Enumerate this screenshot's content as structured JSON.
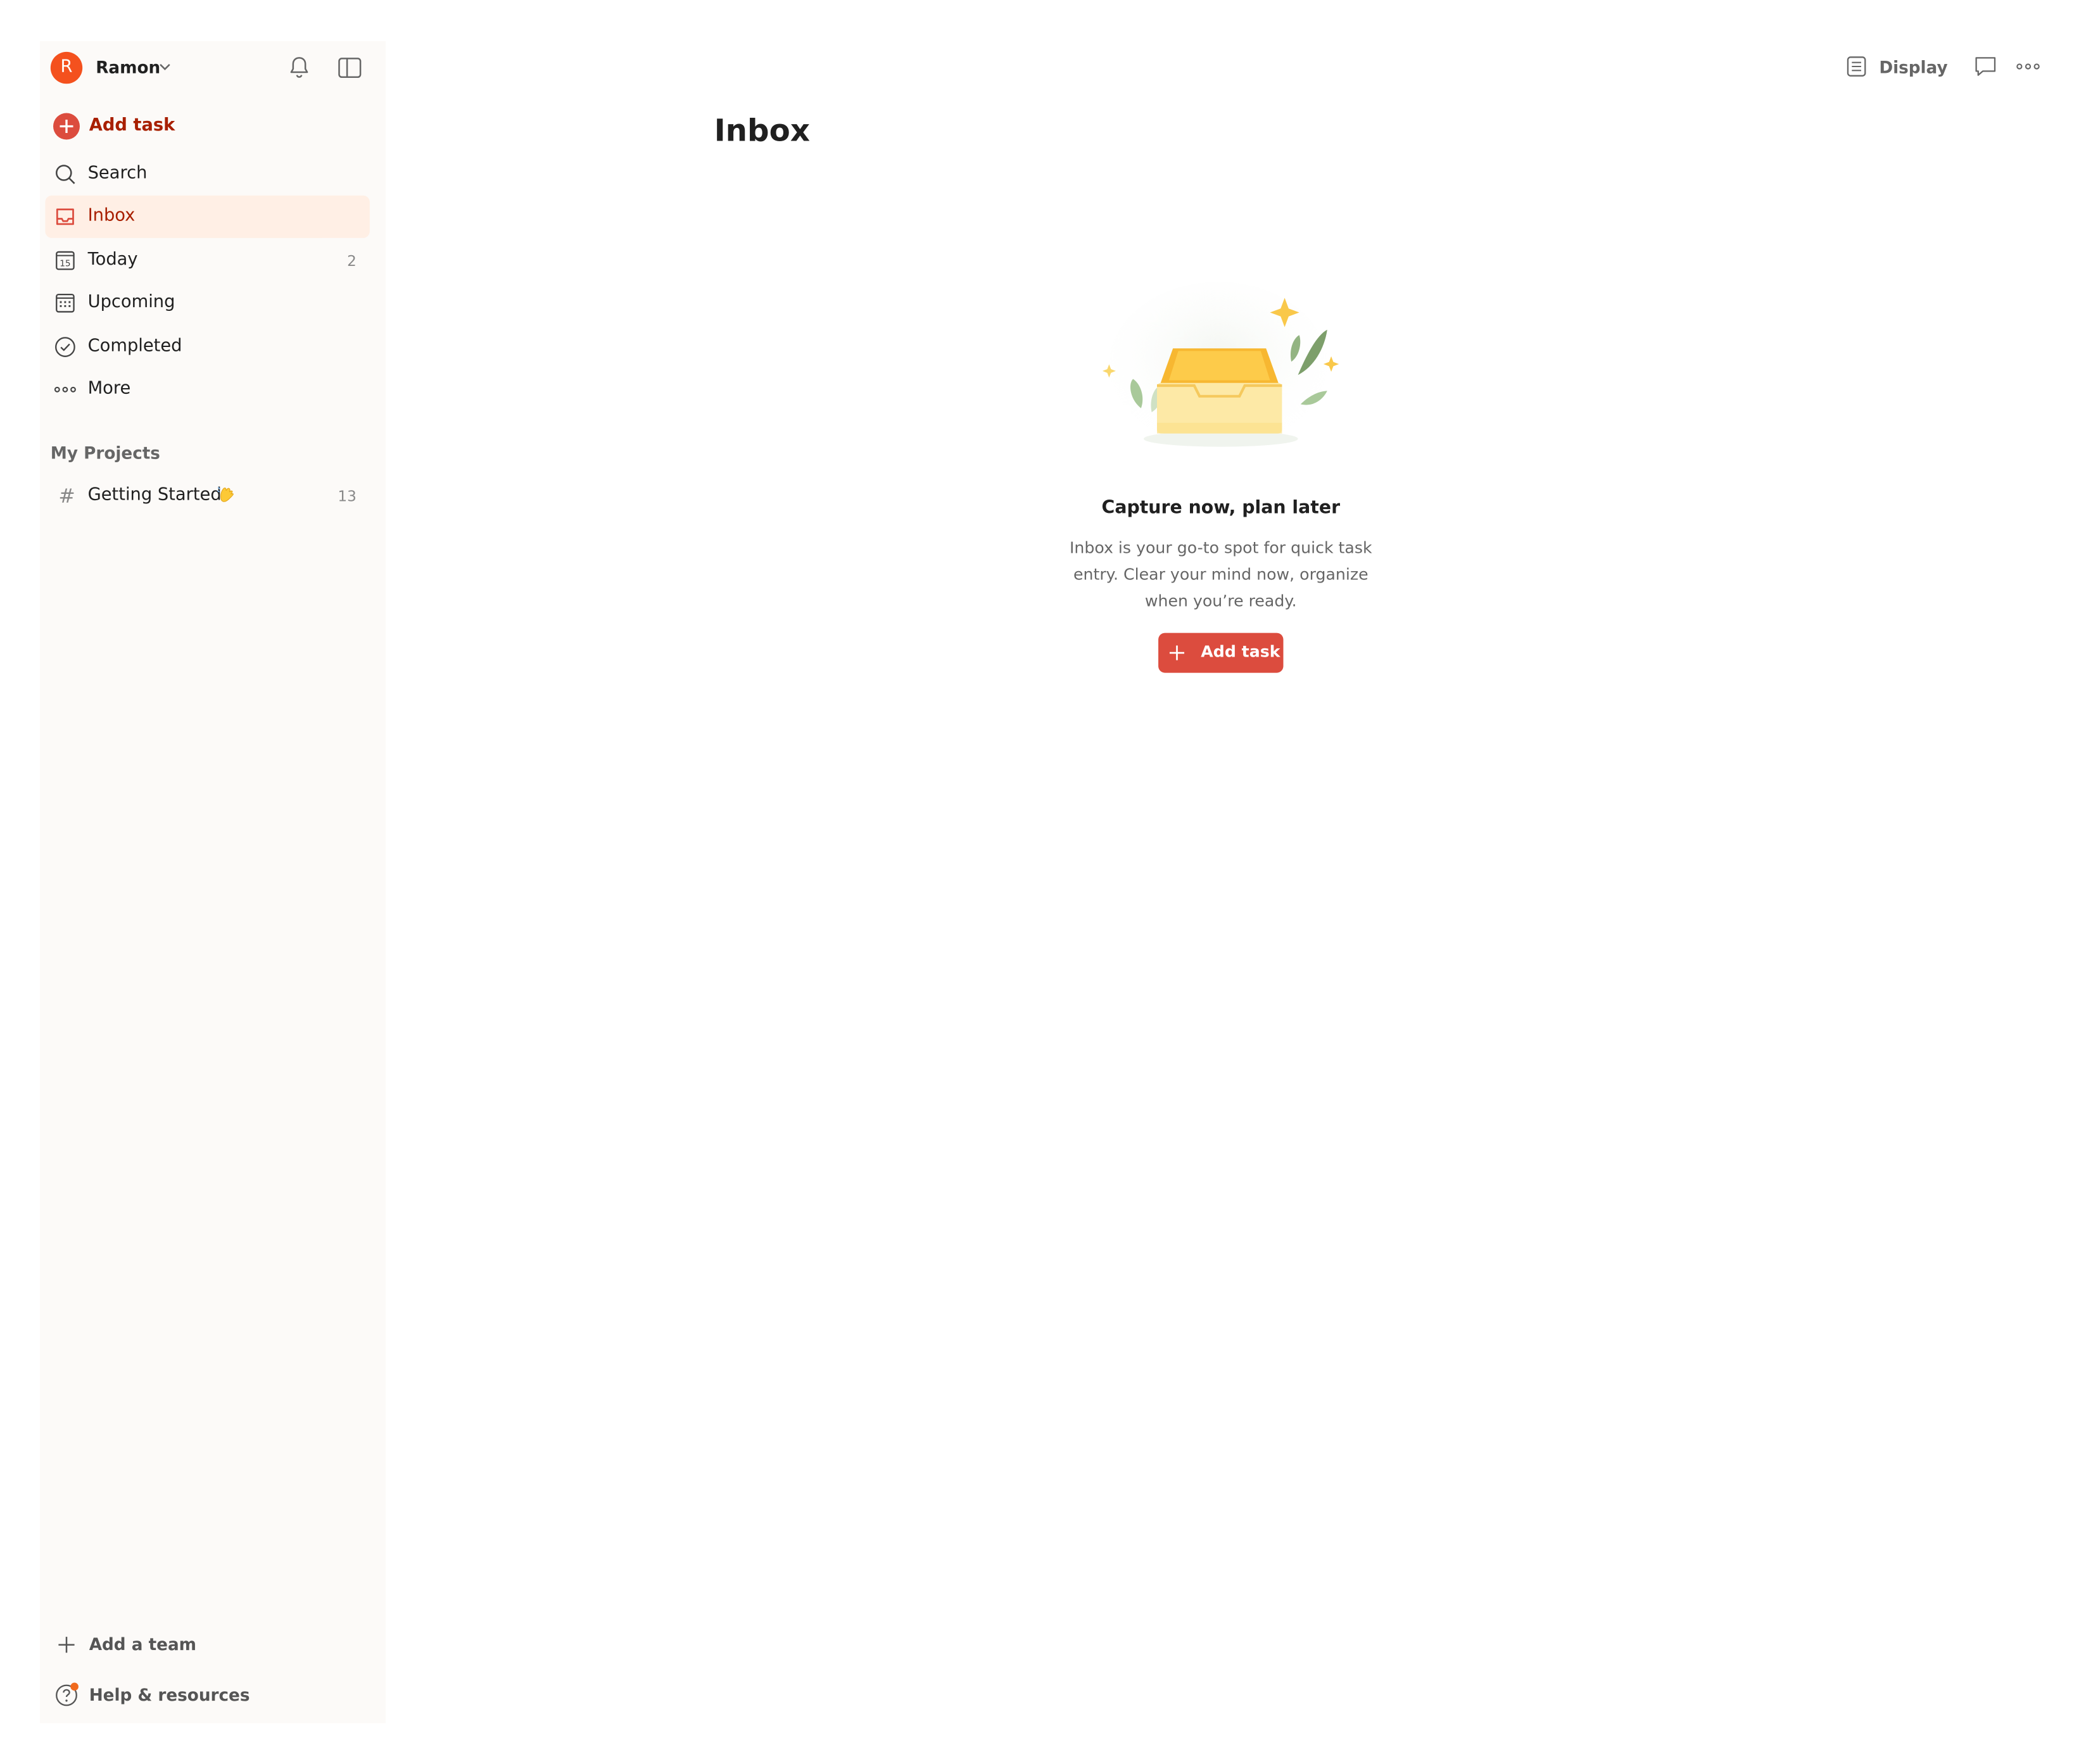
{
  "sidebar": {
    "user": {
      "initial": "R",
      "name": "Ramon"
    },
    "add_task_label": "Add task",
    "nav": [
      {
        "label": "Search",
        "icon": "search-icon"
      },
      {
        "label": "Inbox",
        "icon": "inbox-icon",
        "active": true
      },
      {
        "label": "Today",
        "icon": "calendar-today-icon",
        "count": "2",
        "date": "15"
      },
      {
        "label": "Upcoming",
        "icon": "calendar-grid-icon"
      },
      {
        "label": "Completed",
        "icon": "check-circle-icon"
      },
      {
        "label": "More",
        "icon": "more-dots-icon"
      }
    ],
    "projects_title": "My Projects",
    "projects": [
      {
        "hash": "#",
        "name": "Getting Started",
        "count": "13"
      }
    ],
    "add_team_label": "Add a team",
    "help_label": "Help & resources"
  },
  "toolbar": {
    "display_label": "Display"
  },
  "main": {
    "title": "Inbox",
    "empty_title": "Capture now, plan later",
    "empty_desc": "Inbox is your go-to spot for quick task entry. Clear your mind now, organize when you’re ready.",
    "add_task_label": "Add task"
  },
  "colors": {
    "accent": "#dc4c3e",
    "accent_dark": "#a81f00",
    "active_bg": "#ffefe5",
    "sidebar_bg": "#fcfaf8",
    "avatar": "#f4511e"
  }
}
